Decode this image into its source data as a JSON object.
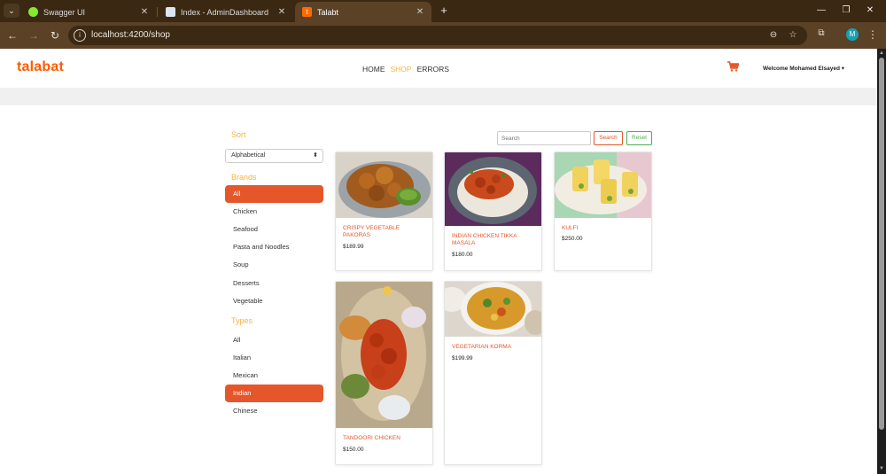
{
  "browser": {
    "tabs": [
      {
        "title": "Swagger UI",
        "color": "#85ea2d"
      },
      {
        "title": "Index - AdminDashboard",
        "color": "#d8e6f5"
      },
      {
        "title": "Talabt",
        "color": "#ff6a00"
      }
    ],
    "url": "localhost:4200/shop",
    "profile_initial": "M"
  },
  "header": {
    "logo": "talabat",
    "nav": {
      "home": "HOME",
      "shop": "SHOP",
      "errors": "ERRORS"
    },
    "welcome": "Welcome Mohamed Elsayed ▾"
  },
  "sidebar": {
    "sort_heading": "Sort",
    "sort_value": "Alphabetical",
    "brands_heading": "Brands",
    "brands": [
      "All",
      "Chicken",
      "Seafood",
      "Pasta and Noodles",
      "Soup",
      "Desserts",
      "Vegetable"
    ],
    "types_heading": "Types",
    "types": [
      "All",
      "Italian",
      "Mexican",
      "Indian",
      "Chinese"
    ]
  },
  "search": {
    "placeholder": "Search",
    "search_label": "Search",
    "reset_label": "Reset"
  },
  "products": [
    {
      "name": "CRISPY VEGETABLE PAKORAS",
      "price": "$189.99"
    },
    {
      "name": "INDIAN CHICKEN TIKKA MASALA",
      "price": "$180.00"
    },
    {
      "name": "KULFI",
      "price": "$250.00"
    },
    {
      "name": "TANDOORI CHICKEN",
      "price": "$150.00"
    },
    {
      "name": "VEGETARIAN KORMA",
      "price": "$199.99"
    }
  ],
  "colors": {
    "brand": "#ff5a00",
    "accent": "#e5562a",
    "nav_active": "#f7b541",
    "reset": "#4caf50"
  }
}
